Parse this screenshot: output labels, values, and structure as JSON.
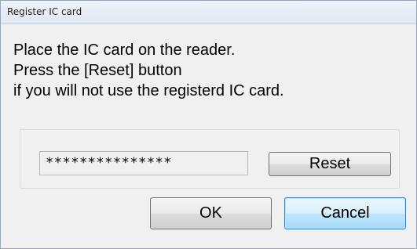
{
  "window": {
    "title": "Register IC card"
  },
  "message": {
    "line1": "Place the IC card on the reader.",
    "line2": "Press the [Reset] button",
    "line3": "if you will not use the registerd IC card."
  },
  "card": {
    "masked_value": "***************",
    "reset_label": "Reset"
  },
  "buttons": {
    "ok_label": "OK",
    "cancel_label": "Cancel"
  },
  "colors": {
    "dialog_background": "#f0f0f0",
    "focused_button_border": "#3c7fb1"
  }
}
